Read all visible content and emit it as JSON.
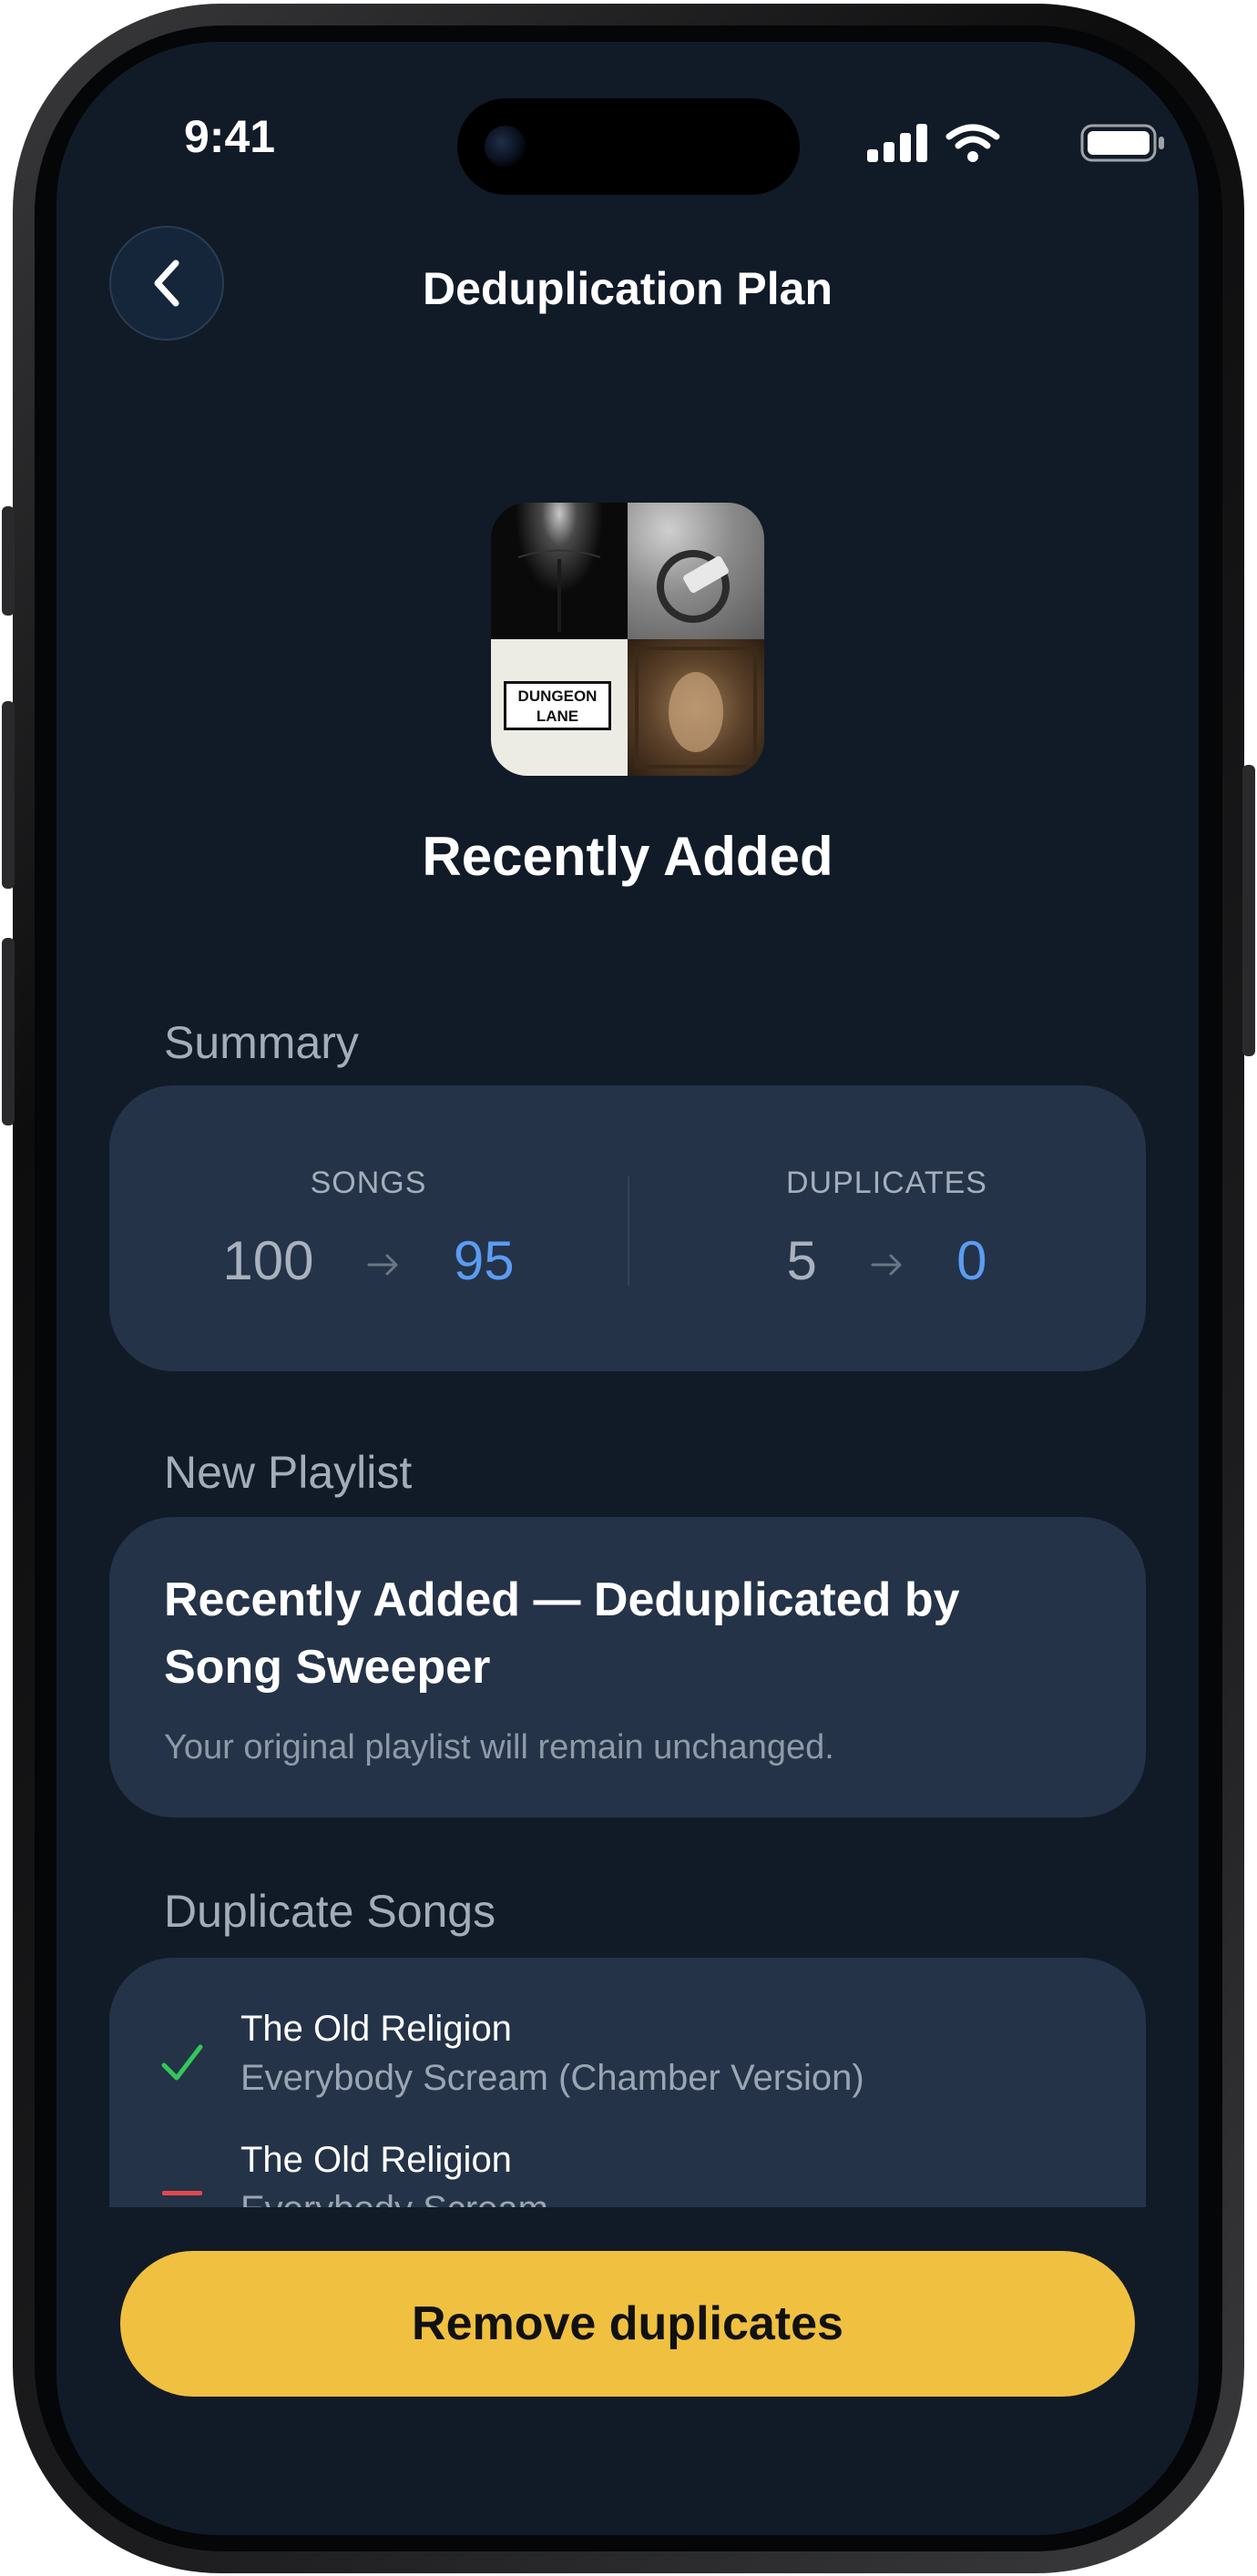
{
  "status_bar": {
    "time": "9:41"
  },
  "nav": {
    "title": "Deduplication Plan"
  },
  "playlist": {
    "name": "Recently Added"
  },
  "artwork": {
    "tiles": [
      {
        "text": ""
      },
      {
        "text": ""
      },
      {
        "line1": "DUNGEON",
        "line2": "LANE"
      },
      {
        "text": ""
      }
    ]
  },
  "summary": {
    "label": "Summary",
    "songs": {
      "header": "SONGS",
      "before": "100",
      "after": "95"
    },
    "duplicates": {
      "header": "DUPLICATES",
      "before": "5",
      "after": "0"
    }
  },
  "new_playlist": {
    "label": "New Playlist",
    "title": "Recently Added — Deduplicated by Song Sweeper",
    "note": "Your original playlist will remain unchanged."
  },
  "duplicate_songs": {
    "label": "Duplicate Songs",
    "items": [
      {
        "title": "The Old Religion",
        "subtitle": "Everybody Scream (Chamber Version)",
        "status": "keep"
      },
      {
        "title": "The Old Religion",
        "subtitle": "Everybody Scream",
        "status": "remove"
      }
    ]
  },
  "cta": {
    "label": "Remove duplicates"
  },
  "colors": {
    "background": "#111b28",
    "card": "#243348",
    "accent_blue": "#5b9cf2",
    "cta_yellow": "#f0c040",
    "keep_green": "#34c759",
    "remove_red": "#e5484d"
  }
}
